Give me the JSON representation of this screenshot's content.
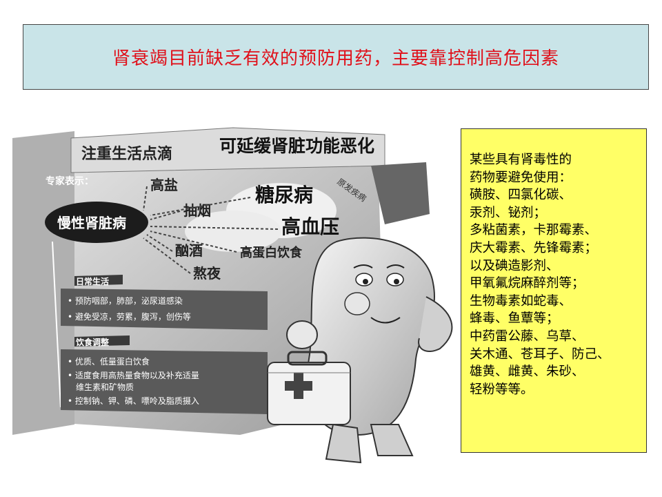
{
  "title": "肾衰竭目前缺乏有效的预防用药，主要靠控制高危因素",
  "poster": {
    "headline_left": "注重生活点滴",
    "headline_right": "可延缓肾脏功能恶化",
    "expert_label": "专家表示：",
    "center_label": "慢性肾脏病",
    "factors": [
      "高盐",
      "抽烟",
      "酗酒",
      "熬夜"
    ],
    "diseases": [
      "糖尿病",
      "高血压",
      "高蛋白饮食"
    ],
    "primary_label": "原发疾病",
    "daily_title": "日常生活",
    "daily_items": [
      "• 预防咽部，肺部，泌尿道感染",
      "• 避免受凉，劳累，腹泻，创伤等"
    ],
    "diet_title": "饮食调整",
    "diet_items": [
      "• 优质、低量蛋白饮食",
      "• 适度食用高热量食物以及补充适量",
      "维生素和矿物质",
      "• 控制钠、钾、磷、嘌呤及脂质摄入"
    ]
  },
  "sidebox": {
    "lines": [
      "某些具有肾毒性的",
      "药物要避免使用：",
      "磺胺、四氯化碳、",
      "汞剂、铋剂；",
      "多粘菌素，卡那霉素、",
      "庆大霉素、先锋霉素；",
      "以及碘造影剂、",
      "甲氧氟烷麻醉剂等；",
      "生物毒素如蛇毒、",
      "蜂毒、鱼蕈等；",
      "中药雷公藤、乌草、",
      "关木通、苍耳子、防己、",
      "雄黄、雌黄、朱砂、",
      "轻粉等等。"
    ]
  }
}
